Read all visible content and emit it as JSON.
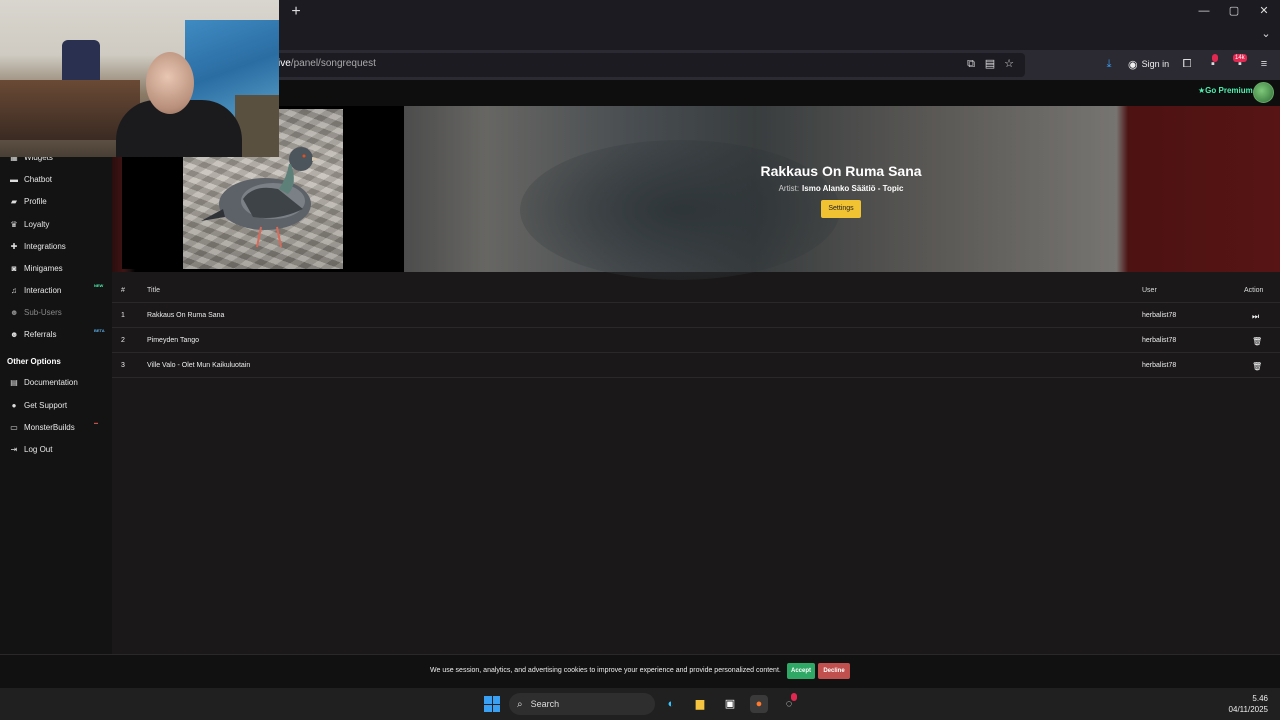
{
  "browser": {
    "new_tab_symbol": "+",
    "window_controls": [
      "—",
      "▢",
      "✕"
    ],
    "url_host_fragment": "ive",
    "url_path": "/panel/songrequest",
    "sign_in_label": "Sign in",
    "extension_badge": "14k"
  },
  "header": {
    "premium_label": "Go Premium"
  },
  "sidebar": {
    "items": [
      {
        "label": "Widgets",
        "icon": "grid-icon"
      },
      {
        "label": "Chatbot",
        "icon": "chat-icon"
      },
      {
        "label": "Profile",
        "icon": "folder-icon"
      },
      {
        "label": "Loyalty",
        "icon": "trophy-icon"
      },
      {
        "label": "Integrations",
        "icon": "puzzle-icon"
      },
      {
        "label": "Minigames",
        "icon": "gamepad-icon"
      },
      {
        "label": "Interaction",
        "icon": "music-icon",
        "tag": "NEW"
      },
      {
        "label": "Sub-Users",
        "icon": "users-icon"
      },
      {
        "label": "Referrals",
        "icon": "users-icon",
        "tag": "BETA"
      }
    ],
    "other_options_heading": "Other Options",
    "other_items": [
      {
        "label": "Documentation",
        "icon": "document-icon"
      },
      {
        "label": "Get Support",
        "icon": "help-icon"
      },
      {
        "label": "MonsterBuilds",
        "icon": "laptop-icon"
      },
      {
        "label": "Log Out",
        "icon": "logout-icon"
      }
    ]
  },
  "now_playing": {
    "title": "Rakkaus On Ruma Sana",
    "artist_label": "Artist:",
    "artist": "Ismo Alanko Säätiö - Topic",
    "settings_label": "Settings"
  },
  "queue": {
    "columns": {
      "num": "#",
      "title": "Title",
      "user": "User",
      "action": "Action"
    },
    "rows": [
      {
        "num": "1",
        "title": "Rakkaus On Ruma Sana",
        "user": "herbalist78",
        "action": "skip"
      },
      {
        "num": "2",
        "title": "Pimeyden Tango",
        "user": "herbalist78",
        "action": "delete"
      },
      {
        "num": "3",
        "title": "Ville Valo - Olet Mun Kaikuluotain",
        "user": "herbalist78",
        "action": "delete"
      }
    ]
  },
  "cookie": {
    "text": "We use session, analytics, and advertising cookies to improve your experience and provide personalized content.",
    "accept_label": "Accept",
    "decline_label": "Decline"
  },
  "taskbar": {
    "search_label": "Search",
    "time": "5.46",
    "date": "04/11/2025"
  },
  "colors": {
    "accent_premium": "#4ef0b0",
    "settings_button": "#f1c232",
    "accept": "#2fa866",
    "decline": "#c0504d",
    "badge": "#e22850"
  }
}
